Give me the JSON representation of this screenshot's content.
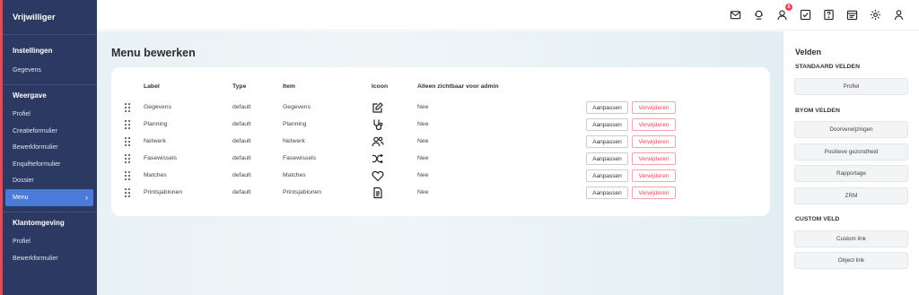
{
  "sidebar": {
    "brand": "Vrijwilliger",
    "sections": [
      {
        "heading": "Instellingen",
        "items": [
          "Gegevens"
        ]
      },
      {
        "heading": "Weergave",
        "items": [
          "Profiel",
          "Creatieformulier",
          "Bewerkformulier",
          "Enquêteformulier",
          "Dossier",
          "Menu"
        ],
        "active": "Menu"
      },
      {
        "heading": "Klantomgeving",
        "items": [
          "Profiel",
          "Bewerkformulier"
        ]
      }
    ],
    "accent_color": "#e8485c",
    "bg_color": "#2c3a63",
    "active_color": "#4a7bdc"
  },
  "topbar": {
    "icons": [
      "mail-icon",
      "headset-icon",
      "user-icon",
      "checkbox-icon",
      "help-icon",
      "calendar-icon",
      "gear-icon",
      "profile-icon"
    ],
    "notification_count": "6"
  },
  "main": {
    "title": "Menu bewerken",
    "columns": [
      "Label",
      "Type",
      "Item",
      "Icoon",
      "Alleen zichtbaar voor admin"
    ],
    "rows": [
      {
        "label": "Gegevens",
        "type": "default",
        "item": "Gegevens",
        "icon": "edit-icon",
        "admin": "Nee"
      },
      {
        "label": "Planning",
        "type": "default",
        "item": "Planning",
        "icon": "stethoscope-icon",
        "admin": "Nee"
      },
      {
        "label": "Netwerk",
        "type": "default",
        "item": "Netwerk",
        "icon": "users-icon",
        "admin": "Nee"
      },
      {
        "label": "Fasewissels",
        "type": "default",
        "item": "Fasewissels",
        "icon": "shuffle-icon",
        "admin": "Nee"
      },
      {
        "label": "Matches",
        "type": "default",
        "item": "Matches",
        "icon": "heart-icon",
        "admin": "Nee"
      },
      {
        "label": "Printsjablonen",
        "type": "default",
        "item": "Printsjablonen",
        "icon": "document-icon",
        "admin": "Nee"
      }
    ],
    "edit_label": "Aanpassen",
    "delete_label": "Verwijderen"
  },
  "right_panel": {
    "title": "Velden",
    "sections": [
      {
        "heading": "STANDAARD VELDEN",
        "fields": [
          "Profiel"
        ]
      },
      {
        "heading": "BYOM VELDEN",
        "fields": [
          "Doorverwijzingen",
          "Positieve gezondheid",
          "Rapportage",
          "ZRM"
        ]
      },
      {
        "heading": "CUSTOM VELD",
        "fields": [
          "Custom link",
          "Object link"
        ]
      }
    ]
  }
}
